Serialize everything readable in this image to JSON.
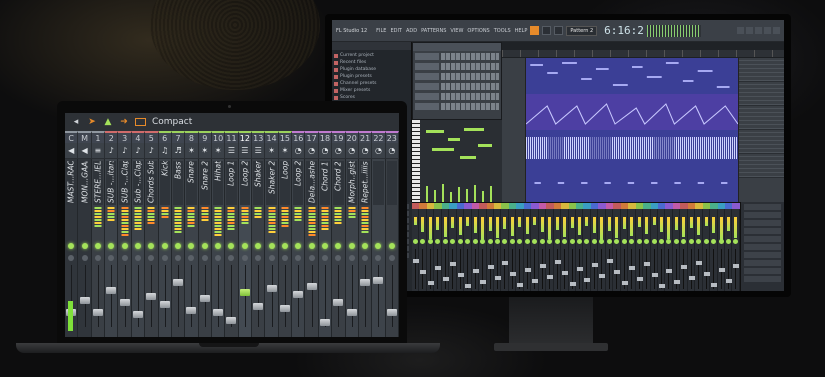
{
  "laptop_mixer": {
    "view_mode_label": "Compact",
    "toolbar_icons": [
      "chevron-left-icon",
      "arrows-icon",
      "pin-icon",
      "arrow-icon",
      "square-icon"
    ],
    "track_numbers": [
      "C",
      "M",
      "1",
      "2",
      "3",
      "4",
      "5",
      "6",
      "7",
      "8",
      "9",
      "10",
      "11",
      "12",
      "13",
      "14",
      "15",
      "16",
      "17",
      "18",
      "19",
      "20",
      "21",
      "22",
      "23"
    ],
    "tracks": [
      {
        "name": "MAST...RACK"
      },
      {
        "name": "MON...GAAL"
      },
      {
        "name": "STERE...IELD"
      },
      {
        "name": "SUB -...itars"
      },
      {
        "name": "SUB -...Clap"
      },
      {
        "name": "Sub -...Clap"
      },
      {
        "name": "Chords Sub"
      },
      {
        "name": "Kick"
      },
      {
        "name": "Bass"
      },
      {
        "name": "Snare"
      },
      {
        "name": "Snare 2"
      },
      {
        "name": "Hihat"
      },
      {
        "name": "Loop 1"
      },
      {
        "name": "Loop 2"
      },
      {
        "name": "Shaker"
      },
      {
        "name": "Shaker 2"
      },
      {
        "name": "Loop"
      },
      {
        "name": "Loop 2"
      },
      {
        "name": "Dela...ashed"
      },
      {
        "name": "Chord 1"
      },
      {
        "name": "Chord 2"
      },
      {
        "name": "Morph..gist"
      },
      {
        "name": "Repet...iiiise"
      },
      {
        "name": ""
      },
      {
        "name": ""
      }
    ],
    "selected_track": "12"
  },
  "desktop": {
    "app_title": "FL Studio 12",
    "menu": [
      "FILE",
      "EDIT",
      "ADD",
      "PATTERNS",
      "VIEW",
      "OPTIONS",
      "TOOLS",
      "HELP"
    ],
    "pattern_label": "Pattern 2",
    "time_display": "6:16:2",
    "playlist_title": "Playlist - Arrangement",
    "browser_items": [
      "Current project",
      "Recent files",
      "Plugin database",
      "Plugin presets",
      "Channel presets",
      "Mixer presets",
      "Scores"
    ],
    "tracks": [
      "Bass",
      "Jam Automation",
      "Scratch",
      "Snare"
    ],
    "accent_colors": {
      "orange": "#e68a2a",
      "green": "#a4e25a",
      "blue": "#3b3f96"
    }
  }
}
